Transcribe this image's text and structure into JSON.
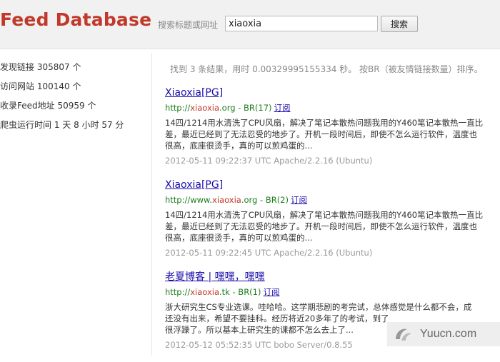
{
  "header": {
    "title": "Feed Database",
    "search_label": "搜索标题或网址",
    "search_value": "xiaoxia",
    "search_button": "搜索"
  },
  "stats": [
    {
      "label": "发现链接 305807 个"
    },
    {
      "label": "访问网站 100140 个"
    },
    {
      "label": "收录Feed地址 50959 个"
    },
    {
      "label": "爬虫运行时间 1 天 8 小时 57 分"
    }
  ],
  "summary": "找到 3 条结果，用时 0.00329995155334 秒。 按BR（被友情链接数量）排序。",
  "results": [
    {
      "title_main": "Xiaoxia",
      "title_tag": "[PG]",
      "url_prefix": "http://",
      "url_highlight": "xiaoxia",
      "url_suffix": ".org",
      "rank": " - BR(17)",
      "subscribe": "订阅",
      "desc_lines": [
        "14四/1214用水清洗了CPU风扇，解决了笔记本散热问题我用的Y460笔记本散热一直比",
        "差，最近已经到了无法忍受的地步了。开机一段时间后，即使不怎么运行软件，温度也",
        "很高，底座很烫手，真的可以煎鸡蛋的..."
      ],
      "footer": "2012-05-11 09:22:37 UTC Apache/2.2.16 (Ubuntu)"
    },
    {
      "title_main": "Xiaoxia",
      "title_tag": "[PG]",
      "url_prefix": "http://www.",
      "url_highlight": "xiaoxia",
      "url_suffix": ".org",
      "rank": " - BR(2)",
      "subscribe": "订阅",
      "desc_lines": [
        "14四/1214用水清洗了CPU风扇，解决了笔记本散热问题我用的Y460笔记本散热一直比",
        "差，最近已经到了无法忍受的地步了。开机一段时间后，即使不怎么运行软件，温度也",
        "很高，底座很烫手，真的可以煎鸡蛋的..."
      ],
      "footer": "2012-05-11 09:22:45 UTC Apache/2.2.16 (Ubuntu)"
    },
    {
      "title_main": "老夏博客 | 嘿嘿，嘿嘿",
      "title_tag": "",
      "url_prefix": "http://",
      "url_highlight": "xiaoxia",
      "url_suffix": ".tk",
      "rank": " - BR(1)",
      "subscribe": "订阅",
      "desc_lines": [
        "浙大研究生CS专业选课。哇哈哈。这学期悲剧的考完试，总体感觉是什么都不会，成",
        "还没有出来，希望不要挂科。经历将近20多年了的考试，到了",
        "很浮躁了。所以基本上研究生的课都不怎么去上了..."
      ],
      "footer": "2012-05-12 05:52:35 UTC bobo Server/0.8.55"
    }
  ],
  "watermark": {
    "text": "Yuucn.com"
  }
}
